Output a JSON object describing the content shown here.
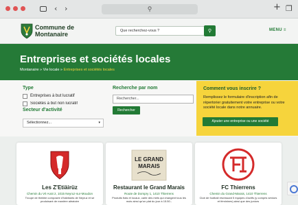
{
  "browser": {
    "url_display": "",
    "icons": [
      "sidebar-icon",
      "back-icon",
      "forward-icon",
      "new-tab-icon",
      "tabs-icon"
    ]
  },
  "header": {
    "logo_line1": "Commune de",
    "logo_line2": "Montanaire",
    "search_placeholder": "Que recherchez-vous ?",
    "menu_label": "MENU ≡"
  },
  "hero": {
    "title": "Entreprises et sociétés locales",
    "breadcrumb": [
      {
        "label": "Montanaire"
      },
      {
        "label": "Vie locale"
      },
      {
        "label": "Entreprises et sociétés locales"
      }
    ],
    "separator": " » "
  },
  "filters": {
    "type_label": "Type",
    "checkbox_1": "Entreprises à but lucratif",
    "checkbox_2": "Sociétés à but non lucratif",
    "sector_label": "Secteur d'activité",
    "sector_selected": "Sélectionnez...",
    "name_label": "Recherche par nom",
    "name_placeholder": "Rechercher...",
    "search_button": "Rechercher"
  },
  "inscribe": {
    "title": "Comment vous inscrire ?",
    "text": "Remplissez le formulaire d'inscription afin de répertorier gratuitement votre entreprise ou votre société locale dans notre annuaire.",
    "button": "Ajouter une entreprise ou une société"
  },
  "cards": [
    {
      "name": "Les Z'Etiäirüz",
      "address": "Chemin du Vé Aoüt 2, 1015 Neyruz-sur-Moudon",
      "desc": "Troupe de théâtre composée d'habitants de Neyruz et se produisant de manière aléatoire"
    },
    {
      "name": "Restaurant le Grand Marais",
      "logo_text_1": "LE GRAND",
      "logo_text_2": "MARAIS",
      "address": "Route de Dompry 1, 1410 Thierrens",
      "desc": "Produits frais et locaux, carte des mets qui changent tous les mois ainsi qu'un plat du jour à 15.50.-"
    },
    {
      "name": "FC Thierrens",
      "address": "Chemin du Grand-Marais, 1410 Thierrens",
      "desc": "Club de football réunissant 5 équipes d'actifs (y compris séniors et féminines) ainsi que des juniors"
    }
  ],
  "colors": {
    "brand_green": "#257a37",
    "accent_yellow": "#f6d43c",
    "close_red": "#e05454"
  }
}
